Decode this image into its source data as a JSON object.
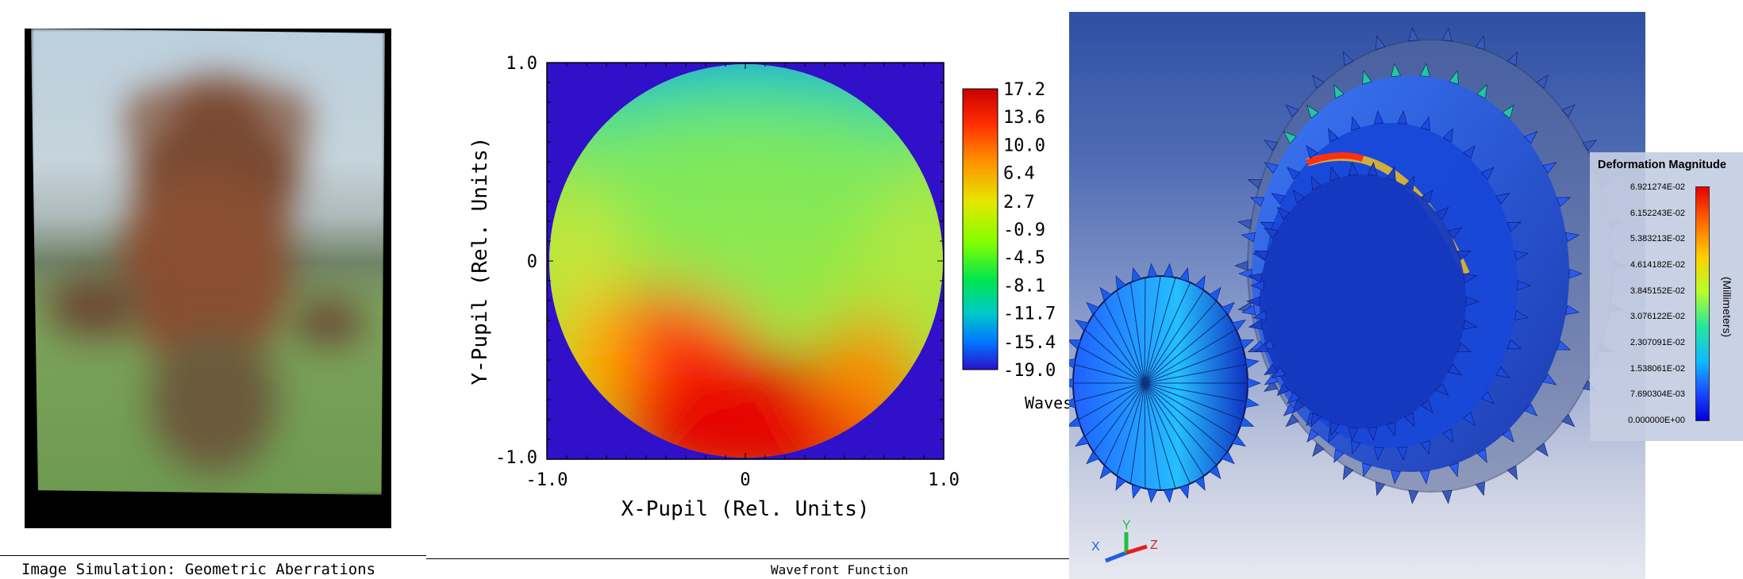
{
  "panels": {
    "image_simulation": {
      "caption": "Image Simulation: Geometric Aberrations"
    },
    "wavefront": {
      "caption": "Wavefront Function",
      "x_axis_label": "X-Pupil (Rel. Units)",
      "y_axis_label": "Y-Pupil (Rel. Units)",
      "x_ticks": [
        "-1.0",
        "0",
        "1.0"
      ],
      "y_ticks": [
        "1.0",
        "0",
        "-1.0"
      ],
      "colorbar_ticks": [
        "17.2",
        "13.6",
        "10.0",
        "6.4",
        "2.7",
        "-0.9",
        "-4.5",
        "-8.1",
        "-11.7",
        "-15.4",
        "-19.0"
      ],
      "colorbar_unit": "Waves",
      "colors": {
        "background": "#3010c8"
      }
    },
    "fea": {
      "legend_title": "Deformation Magnitude",
      "legend_unit": "(Millimeters)",
      "legend_ticks": [
        "6.921274E-02",
        "6.152243E-02",
        "5.383213E-02",
        "4.614182E-02",
        "3.845152E-02",
        "3.076122E-02",
        "2.307091E-02",
        "1.538061E-02",
        "7.690304E-03",
        "0.000000E+00"
      ],
      "triad_labels": {
        "x": "X",
        "y": "Y",
        "z": "Z"
      },
      "colors": {
        "background_top": "#2f4fa4",
        "x_axis": "#2060e0",
        "y_axis": "#20c040",
        "z_axis": "#e02020"
      }
    }
  },
  "chart_data": {
    "type": "heatmap",
    "title": "Wavefront Function",
    "xlabel": "X-Pupil (Rel. Units)",
    "ylabel": "Y-Pupil (Rel. Units)",
    "xlim": [
      -1.0,
      1.0
    ],
    "ylim": [
      -1.0,
      1.0
    ],
    "colorbar": {
      "label": "Waves",
      "min": -19.0,
      "max": 17.2,
      "ticks": [
        17.2,
        13.6,
        10.0,
        6.4,
        2.7,
        -0.9,
        -4.5,
        -8.1,
        -11.7,
        -15.4,
        -19.0
      ]
    },
    "regions": [
      {
        "x": 0.0,
        "y": 0.9,
        "value": -15.4
      },
      {
        "x": 0.0,
        "y": 0.5,
        "value": -5.0
      },
      {
        "x": 0.0,
        "y": 0.0,
        "value": -2.0
      },
      {
        "x": -0.9,
        "y": 0.0,
        "value": 0.0
      },
      {
        "x": 0.9,
        "y": 0.0,
        "value": -1.0
      },
      {
        "x": -0.4,
        "y": -0.5,
        "value": 13.0
      },
      {
        "x": 0.0,
        "y": -0.85,
        "value": 16.5
      },
      {
        "x": 0.5,
        "y": -0.6,
        "value": 9.0
      }
    ]
  }
}
